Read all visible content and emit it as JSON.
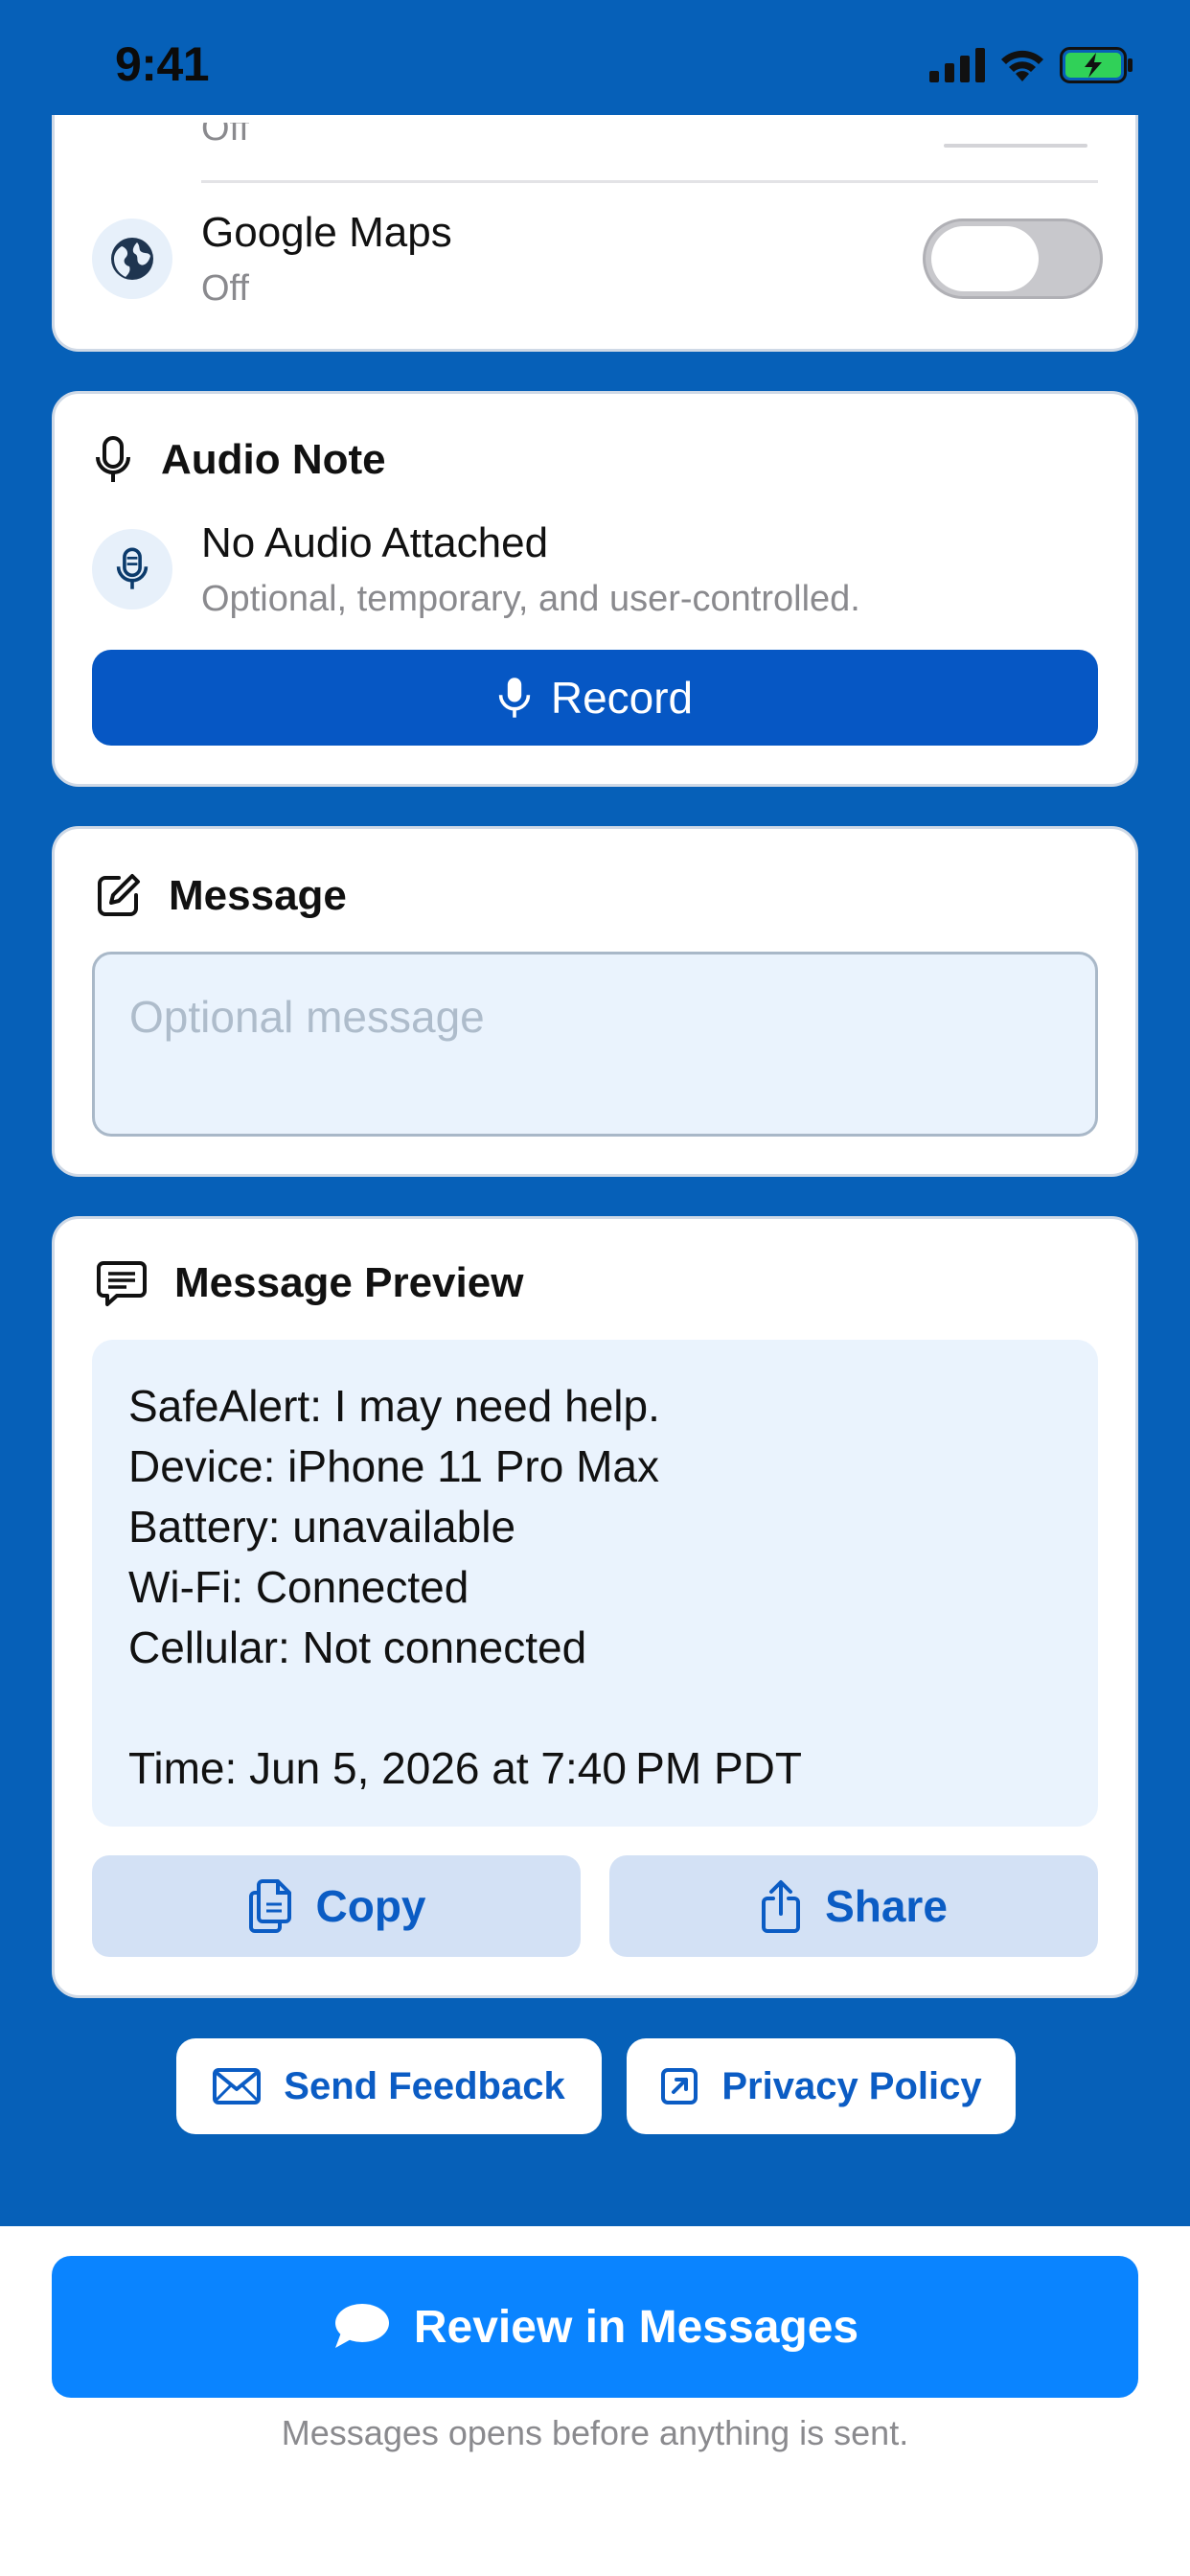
{
  "status_bar": {
    "time": "9:41"
  },
  "location_card": {
    "partial_row_value": "Off",
    "google_maps": {
      "label": "Google Maps",
      "state": "Off"
    }
  },
  "audio_card": {
    "title": "Audio Note",
    "status_title": "No Audio Attached",
    "status_subtitle": "Optional, temporary, and user-controlled.",
    "record_label": "Record"
  },
  "message_card": {
    "title": "Message",
    "placeholder": "Optional message"
  },
  "preview_card": {
    "title": "Message Preview",
    "lines": [
      "SafeAlert: I may need help.",
      "Device: iPhone 11 Pro Max",
      "Battery: unavailable",
      "Wi-Fi: Connected",
      "Cellular: Not connected",
      "",
      "Time: Jun 5, 2026 at 7:40 PM PDT"
    ],
    "copy_label": "Copy",
    "share_label": "Share"
  },
  "links": {
    "feedback_label": "Send Feedback",
    "privacy_label": "Privacy Policy"
  },
  "cta": {
    "label": "Review in Messages",
    "footnote": "Messages opens before anything is sent."
  },
  "colors": {
    "background_blue": "#0660B8",
    "primary_button": "#0657C4",
    "cta_blue": "#0A84FF",
    "secondary_button": "#D3E1F5",
    "battery_green": "#30D158"
  }
}
